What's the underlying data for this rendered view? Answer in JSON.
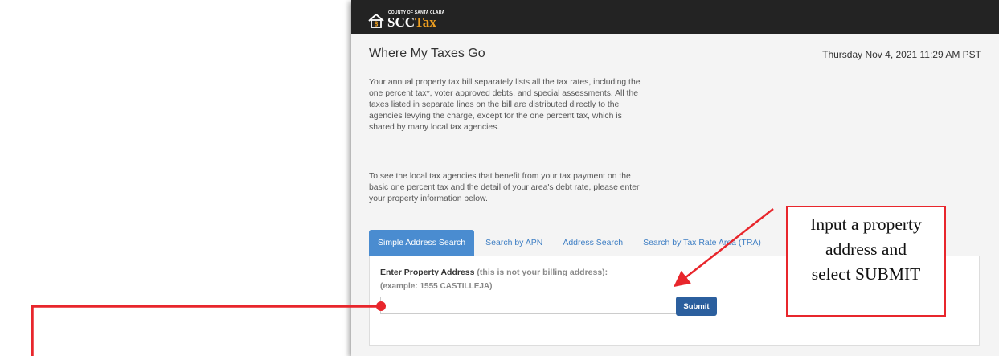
{
  "header": {
    "org_small": "COUNTY OF SANTA CLARA",
    "brand_prefix": "SCC",
    "brand_suffix": "Tax",
    "brand_accent_color": "#f0a020",
    "bar_color": "#232323",
    "logo_icon": "house-dollar-icon"
  },
  "page": {
    "title": "Where My Taxes Go",
    "datetime": "Thursday Nov 4, 2021 11:29 AM PST",
    "paragraph1": "Your annual property tax bill separately lists all the tax rates, including the one percent tax*, voter approved debts, and special assessments. All the taxes listed in separate lines on the bill are distributed directly to the agencies levying the charge, except for the one percent tax, which is shared by many local tax agencies.",
    "paragraph2": "To see the local tax agencies that benefit from your tax payment on the basic one percent tax and the detail of your area's debt rate, please enter your property information below."
  },
  "tabs": [
    {
      "label": "Simple Address Search",
      "active": true
    },
    {
      "label": "Search by APN",
      "active": false
    },
    {
      "label": "Address Search",
      "active": false
    },
    {
      "label": "Search by Tax Rate Area (TRA)",
      "active": false
    }
  ],
  "form": {
    "label": "Enter Property Address",
    "label_note": "(this is not your billing address):",
    "example": "(example: 1555 CASTILLEJA)",
    "input_value": "",
    "submit_label": "Submit",
    "tab_color": "#4a8cd0",
    "button_color": "#2b5f9e"
  },
  "annotation": {
    "line1": "Input a property",
    "line2": "address and",
    "line3": "select SUBMIT",
    "color": "#e8262c"
  }
}
